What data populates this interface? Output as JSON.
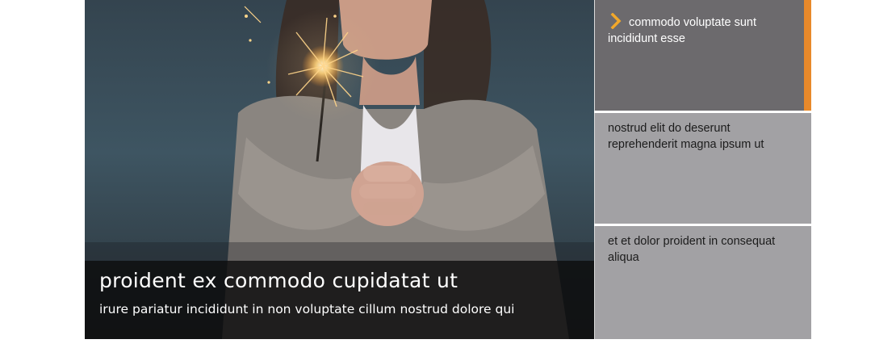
{
  "hero": {
    "image_alt": "woman holding a lit sparkler",
    "title": "proident ex commodo cupidatat ut",
    "subtitle": "irure pariatur incididunt in non voluptate cillum nostrud dolore qui"
  },
  "thumbnails": [
    {
      "label": "commodo voluptate sunt incididunt esse",
      "active": true,
      "icon": "chevron-right-icon"
    },
    {
      "label": "nostrud elit do deserunt reprehenderit magna ipsum ut",
      "active": false
    },
    {
      "label": "et et dolor proident in consequat aliqua",
      "active": false
    }
  ],
  "colors": {
    "accent": "#e8892a",
    "active_bg": "#6c6a6d",
    "inactive_bg": "#a2a1a4",
    "caption_bg": "#0c0c0c"
  }
}
